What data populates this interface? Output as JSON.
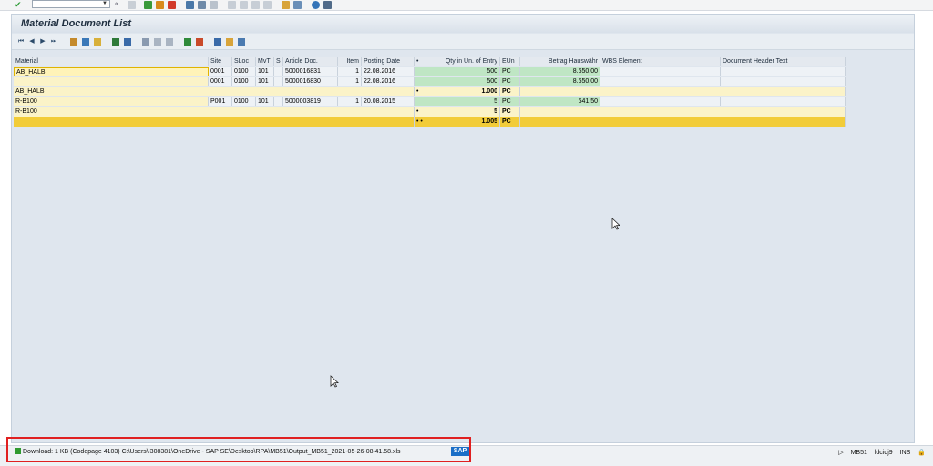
{
  "window": {
    "title": "Material Document List"
  },
  "system_toolbar": {
    "command_field_value": ""
  },
  "grid": {
    "headers": {
      "material": "Material",
      "site": "Site",
      "sloc": "SLoc",
      "mvt": "MvT",
      "s": "S",
      "article_doc": "Article Doc.",
      "item": "Item",
      "posting_date": "Posting Date",
      "dot": "•",
      "qty": "Qty in Un. of Entry",
      "eun": "EUn",
      "betrag": "Betrag Hauswähr",
      "wbs": "WBS Element",
      "doc_header": "Document Header Text"
    },
    "rows": [
      {
        "material": "AB_HALB",
        "site": "0001",
        "sloc": "0100",
        "mvt": "101",
        "article_doc": "5000016831",
        "item": "1",
        "posting_date": "22.08.2016",
        "qty": "500",
        "eun": "PC",
        "betrag": "8.650,00"
      },
      {
        "material": "",
        "site": "0001",
        "sloc": "0100",
        "mvt": "101",
        "article_doc": "5000016830",
        "item": "1",
        "posting_date": "22.08.2016",
        "qty": "500",
        "eun": "PC",
        "betrag": "8.650,00"
      },
      {
        "material": "R-B100",
        "site": "P001",
        "sloc": "0100",
        "mvt": "101",
        "article_doc": "5000003819",
        "item": "1",
        "posting_date": "20.08.2015",
        "qty": "5",
        "eun": "PC",
        "betrag": "641,50"
      }
    ],
    "subtotal_1": {
      "material": "AB_HALB",
      "dot": "•",
      "qty": "1.000",
      "eun": "PC"
    },
    "subtotal_2": {
      "material": "R-B100",
      "dot": "•",
      "qty": "5",
      "eun": "PC"
    },
    "total": {
      "dot": "• •",
      "qty": "1.005",
      "eun": "PC"
    }
  },
  "status_bar": {
    "message": "Download: 1 KB (Codepage 4103) C:\\Users\\I308381\\OneDrive - SAP SE\\Desktop\\RPA\\MB51\\Output_MB51_2021-05-26-08.41.58.xls",
    "sap_logo": "SAP",
    "transaction": "MB51",
    "server": "ldciqj9",
    "mode": "INS"
  },
  "colors": {
    "highlight_yellow": "#fff3b8",
    "subtotal_yellow": "#fbf3c8",
    "total_yellow": "#f2cc38",
    "green_cell": "#bfe6c4",
    "frame_red": "#e02020",
    "sap_blue": "#1b6fc7"
  }
}
